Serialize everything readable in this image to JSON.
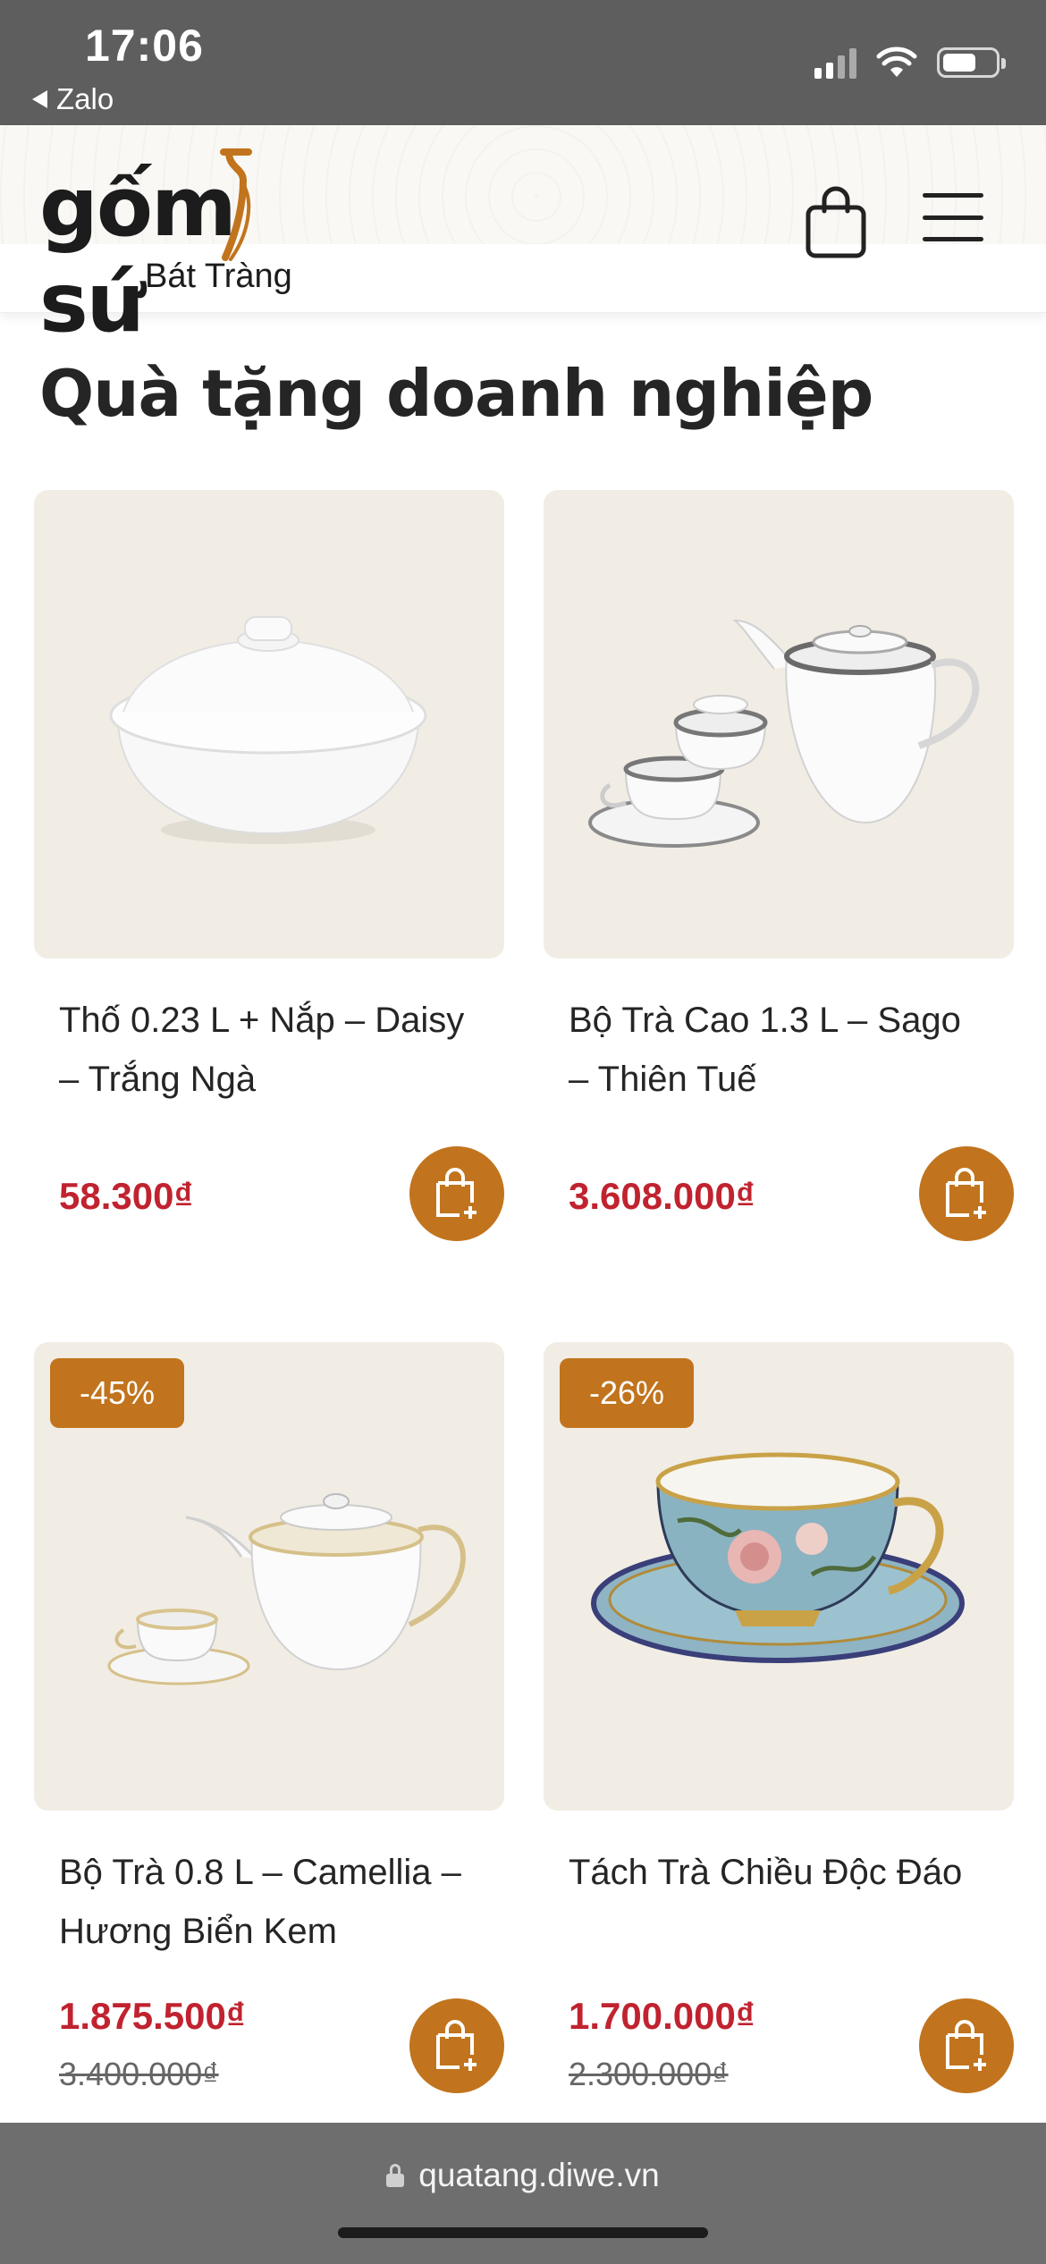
{
  "status_bar": {
    "time": "17:06",
    "back_app": "Zalo",
    "icons": [
      "signal-icon",
      "wifi-icon",
      "battery-icon"
    ]
  },
  "header": {
    "logo_main_left": "gốm",
    "logo_main_right": "sứ",
    "logo_sub": "Bát Tràng",
    "cart_icon": "shopping-bag-icon",
    "menu_icon": "hamburger-menu-icon"
  },
  "page": {
    "title": "Quà tặng doanh nghiệp"
  },
  "products": [
    {
      "name": "Thố 0.23 L + Nắp – Daisy – Trắng Ngà",
      "price": "58.300₫",
      "old_price": "",
      "badge": ""
    },
    {
      "name": "Bộ Trà Cao 1.3 L – Sago – Thiên Tuế",
      "price": "3.608.000₫",
      "old_price": "",
      "badge": ""
    },
    {
      "name": "Bộ Trà 0.8 L – Camellia – Hương Biển Kem",
      "price": "1.875.500₫",
      "old_price": "3.400.000₫",
      "badge": "-45%"
    },
    {
      "name": "Tách Trà Chiều Độc Đáo",
      "price": "1.700.000₫",
      "old_price": "2.300.000₫",
      "badge": "-26%"
    }
  ],
  "browser": {
    "url": "quatang.diwe.vn"
  },
  "colors": {
    "accent": "#c1741d",
    "price": "#c0232f",
    "image_bg": "#f1ede5",
    "status_bar": "#5e5e5e"
  }
}
